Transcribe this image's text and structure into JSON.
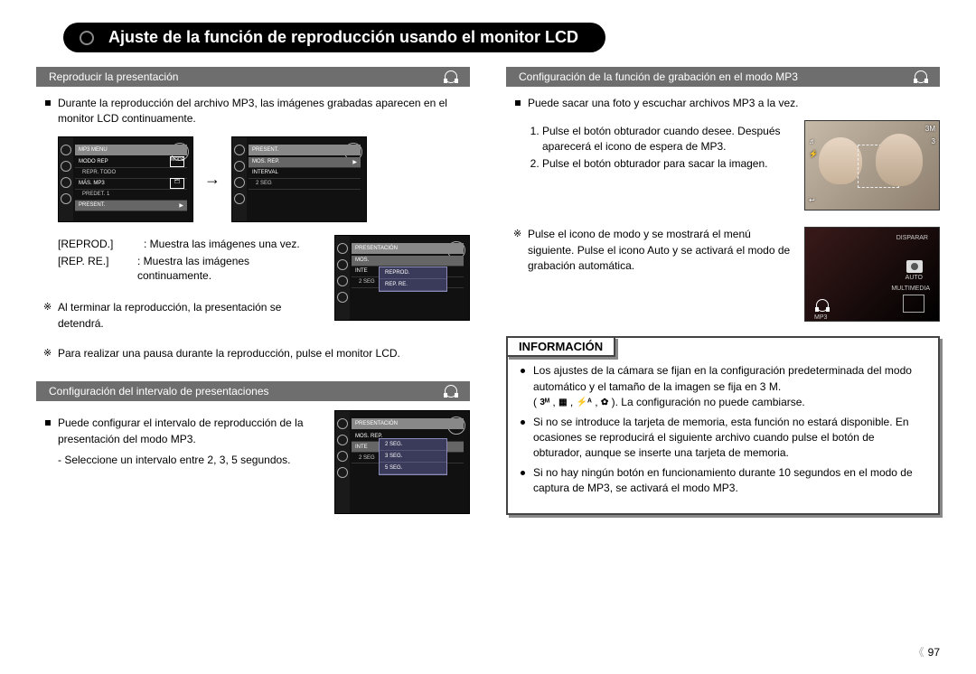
{
  "page_title": "Ajuste de la función de reproducción usando el monitor LCD",
  "page_number": "97",
  "left": {
    "section1": {
      "title": "Reproducir la presentación",
      "para": "Durante la reproducción del archivo MP3, las imágenes grabadas aparecen en el monitor LCD continuamente.",
      "lcd_a": {
        "header": "MP3 MENU",
        "row1": "MODO REP",
        "row1_sub": "REPR. TODO",
        "row1_badge": "MODE",
        "row2": "MÁS. MP3",
        "row2_sub": "PREDET. 1",
        "row3": "PRESENT."
      },
      "lcd_b": {
        "header": "PRESENT.",
        "row1": "MOS. REP.",
        "row2": "INTERVAL",
        "row2_sub": "2 SEG"
      },
      "defs": {
        "k1": "[REPROD.]",
        "v1": ": Muestra las imágenes una vez.",
        "k2": "[REP. RE.]",
        "v2": ": Muestra las imágenes continuamente."
      },
      "lcd_c": {
        "header": "PRESENTACIÓN",
        "row1": "MOS.",
        "row2": "INTE",
        "row2_sub": "2 SEG",
        "opt1": "REPROD.",
        "opt2": "REP. RE."
      },
      "note1": "Al terminar la reproducción, la presentación se detendrá.",
      "note2": "Para realizar una pausa durante la reproducción, pulse el monitor LCD."
    },
    "section2": {
      "title": "Configuración del intervalo de presentaciones",
      "para": "Puede configurar el intervalo de reproducción de la presentación del modo MP3.",
      "sub": "- Seleccione un intervalo entre 2, 3, 5 segundos.",
      "lcd": {
        "header": "PRESENTACIÓN",
        "row1": "MOS. REP.",
        "row2": "INTE",
        "row2_sub": "2 SEG",
        "opt1": "2 SEG.",
        "opt2": "3 SEG.",
        "opt3": "5 SEG."
      }
    }
  },
  "right": {
    "section1": {
      "title": "Configuración de la función de grabación en el modo MP3",
      "para": "Puede sacar una foto y escuchar archivos MP3 a la vez.",
      "step1": "Pulse el botón obturador cuando desee. Después aparecerá el icono de espera de MP3.",
      "step2": "Pulse el botón obturador para sacar la imagen.",
      "photo_badge_tr": "3M",
      "photo_badge_r": "3",
      "note": "Pulse el icono de modo y se mostrará el menú siguiente. Pulse el icono Auto y se activará el modo de grabación automática.",
      "mode": {
        "top": "DISPARAR",
        "mid": "AUTO",
        "bot": "MULTIMEDIA",
        "mp3": "MP3"
      }
    },
    "info": {
      "title": "INFORMACIÓN",
      "b1": "Los ajustes de la cámara se fijan en la configuración predeterminada del modo automático y el tamaño de la imagen se fija en 3 M.",
      "b1_tail": "La configuración no puede cambiarse.",
      "sym1": "3ᴹ",
      "sym2": "▦",
      "sym3": "⚡ᴬ",
      "sym4": "✿",
      "b2": "Si no se introduce la tarjeta de memoria, esta función no estará disponible. En ocasiones se reproducirá el siguiente archivo cuando pulse el botón de obturador, aunque se inserte una tarjeta de memoria.",
      "b3": "Si no hay ningún botón en funcionamiento durante 10 segundos en el modo de captura de MP3, se activará el modo MP3."
    }
  }
}
